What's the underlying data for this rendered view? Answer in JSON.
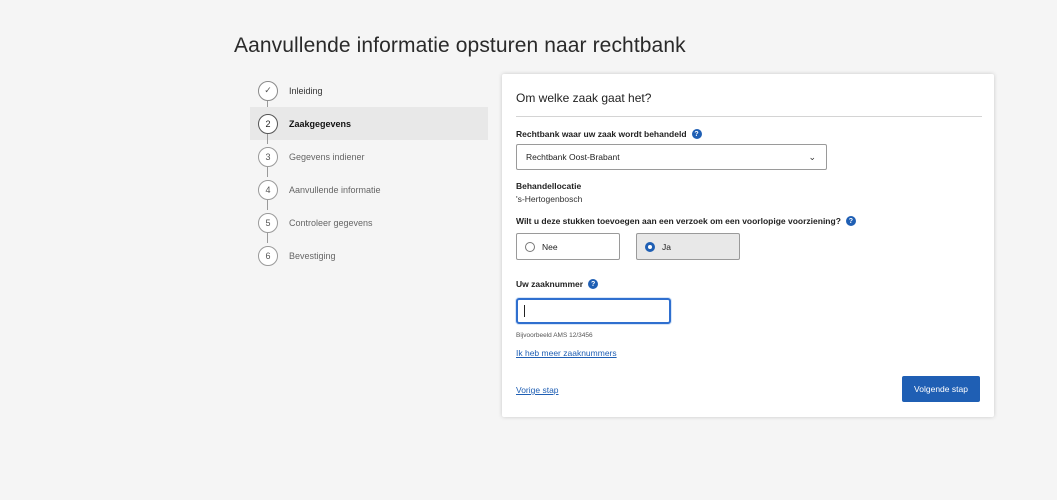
{
  "page": {
    "title": "Aanvullende informatie opsturen naar rechtbank"
  },
  "stepper": {
    "steps": [
      {
        "number": "✓",
        "label": "Inleiding",
        "state": "done"
      },
      {
        "number": "2",
        "label": "Zaakgegevens",
        "state": "active"
      },
      {
        "number": "3",
        "label": "Gegevens indiener",
        "state": "todo"
      },
      {
        "number": "4",
        "label": "Aanvullende informatie",
        "state": "todo"
      },
      {
        "number": "5",
        "label": "Controleer gegevens",
        "state": "todo"
      },
      {
        "number": "6",
        "label": "Bevestiging",
        "state": "todo"
      }
    ]
  },
  "form": {
    "title": "Om welke zaak gaat het?",
    "court_label": "Rechtbank waar uw zaak wordt behandeld",
    "court_value": "Rechtbank Oost-Brabant",
    "location_label": "Behandellocatie",
    "location_value": "'s-Hertogenbosch",
    "question_label": "Wilt u deze stukken toevoegen aan een verzoek om een voorlopige voorziening?",
    "option_no": "Nee",
    "option_yes": "Ja",
    "selected_option": "Ja",
    "case_number_label": "Uw zaaknummer",
    "case_number_value": "",
    "case_number_hint": "Bijvoorbeeld AMS 12/3456",
    "more_numbers_link": "Ik heb meer zaaknummers",
    "previous_link": "Vorige stap",
    "next_button": "Volgende stap"
  },
  "colors": {
    "accent": "#1f5fb4",
    "background": "#f5f5f5",
    "active_step": "#e8e8e8"
  },
  "icons": {
    "help": "question-circle-icon",
    "select": "chevron-down-icon",
    "done": "check-icon"
  }
}
